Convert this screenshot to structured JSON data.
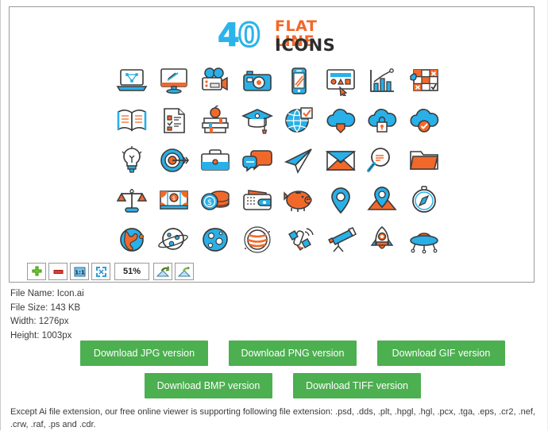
{
  "viewer": {
    "logo": {
      "number": "40",
      "line1": "FLAT LINE",
      "line2": "ICONS",
      "number_color": "#2bb3ea",
      "line1_color": "#f2682a",
      "line2_color": "#2d2d2d"
    },
    "icons": [
      {
        "name": "laptop-design-icon",
        "label": "laptop"
      },
      {
        "name": "desktop-monitor-icon",
        "label": "monitor"
      },
      {
        "name": "movie-camera-icon",
        "label": "movie camera"
      },
      {
        "name": "photo-camera-icon",
        "label": "photo camera"
      },
      {
        "name": "smartphone-icon",
        "label": "smartphone"
      },
      {
        "name": "web-design-window-icon",
        "label": "design window"
      },
      {
        "name": "bar-chart-growth-icon",
        "label": "bar chart"
      },
      {
        "name": "checklist-grid-icon",
        "label": "checklist grid"
      },
      {
        "name": "open-book-icon",
        "label": "open book"
      },
      {
        "name": "document-checklist-icon",
        "label": "document"
      },
      {
        "name": "books-apple-icon",
        "label": "books with apple"
      },
      {
        "name": "graduation-cap-icon",
        "label": "graduation cap"
      },
      {
        "name": "globe-check-icon",
        "label": "globe"
      },
      {
        "name": "cloud-download-icon",
        "label": "cloud download"
      },
      {
        "name": "cloud-lock-icon",
        "label": "cloud security"
      },
      {
        "name": "cloud-check-icon",
        "label": "cloud check"
      },
      {
        "name": "lightbulb-idea-icon",
        "label": "lightbulb"
      },
      {
        "name": "target-arrow-icon",
        "label": "target"
      },
      {
        "name": "briefcase-icon",
        "label": "briefcase"
      },
      {
        "name": "chat-bubbles-icon",
        "label": "chat bubbles"
      },
      {
        "name": "paper-plane-icon",
        "label": "paper plane"
      },
      {
        "name": "envelope-mail-icon",
        "label": "envelope"
      },
      {
        "name": "magnifier-search-icon",
        "label": "magnifier"
      },
      {
        "name": "folder-icon",
        "label": "folder"
      },
      {
        "name": "balance-scales-icon",
        "label": "scales"
      },
      {
        "name": "banknote-icon",
        "label": "banknote"
      },
      {
        "name": "coins-stack-icon",
        "label": "coins"
      },
      {
        "name": "wallet-card-icon",
        "label": "wallet"
      },
      {
        "name": "piggy-bank-icon",
        "label": "piggy bank"
      },
      {
        "name": "map-pin-icon",
        "label": "map pin"
      },
      {
        "name": "map-location-icon",
        "label": "map location"
      },
      {
        "name": "compass-icon",
        "label": "compass"
      },
      {
        "name": "earth-globe-icon",
        "label": "earth"
      },
      {
        "name": "planet-rings-icon",
        "label": "planet"
      },
      {
        "name": "moon-crater-icon",
        "label": "moon"
      },
      {
        "name": "jupiter-planet-icon",
        "label": "jupiter"
      },
      {
        "name": "satellite-icon",
        "label": "satellite"
      },
      {
        "name": "telescope-icon",
        "label": "telescope"
      },
      {
        "name": "rocket-icon",
        "label": "rocket"
      },
      {
        "name": "ufo-icon",
        "label": "ufo"
      }
    ],
    "palette": {
      "blue": "#29b0e8",
      "orange": "#f2682a",
      "outline": "#3b3b3b",
      "white": "#ffffff"
    }
  },
  "toolbar": {
    "zoom_in_title": "Zoom In",
    "zoom_out_title": "Zoom Out",
    "actual_size_title": "1:1",
    "fit_screen_title": "Fit to Screen",
    "zoom_value": "51%",
    "rotate_left_title": "Rotate Left",
    "rotate_right_title": "Rotate Right"
  },
  "file_info": {
    "name": "File Name: Icon.ai",
    "size": "File Size: 143 KB",
    "width": "Width: 1276px",
    "height": "Height: 1003px"
  },
  "downloads": {
    "row1": [
      {
        "label": "Download JPG version"
      },
      {
        "label": "Download PNG version"
      },
      {
        "label": "Download GIF version"
      }
    ],
    "row2": [
      {
        "label": "Download BMP version"
      },
      {
        "label": "Download TIFF version"
      }
    ],
    "color": "#4caf50"
  },
  "footer": {
    "text": "Except Ai file extension, our free online viewer is supporting following file extension: .psd, .dds, .plt, .hpgl, .hgl, .pcx, .tga, .eps, .cr2, .nef, .crw, .raf, .ps and .cdr."
  }
}
